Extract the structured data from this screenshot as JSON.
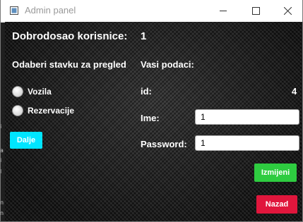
{
  "window": {
    "title": "Admin panel",
    "minimize_icon": "minimize-icon",
    "maximize_icon": "maximize-icon",
    "close_icon": "close-icon"
  },
  "welcome": {
    "label": "Dobrodosao korisnice:",
    "user_id": "1"
  },
  "review": {
    "heading": "Odaberi stavku za pregled",
    "options": [
      "Vozila",
      "Rezervacije"
    ],
    "next_button": "Dalje"
  },
  "account": {
    "heading": "Vasi podaci:",
    "id_label": "id:",
    "id_value": "4",
    "name_label": "Ime:",
    "name_value": "1",
    "password_label": "Password:",
    "password_value": "1",
    "edit_button": "Izmijeni",
    "back_button": "Nazad"
  },
  "colors": {
    "next_button": "#00e5ff",
    "edit_button": "#2ecc40",
    "back_button": "#e0163c"
  }
}
